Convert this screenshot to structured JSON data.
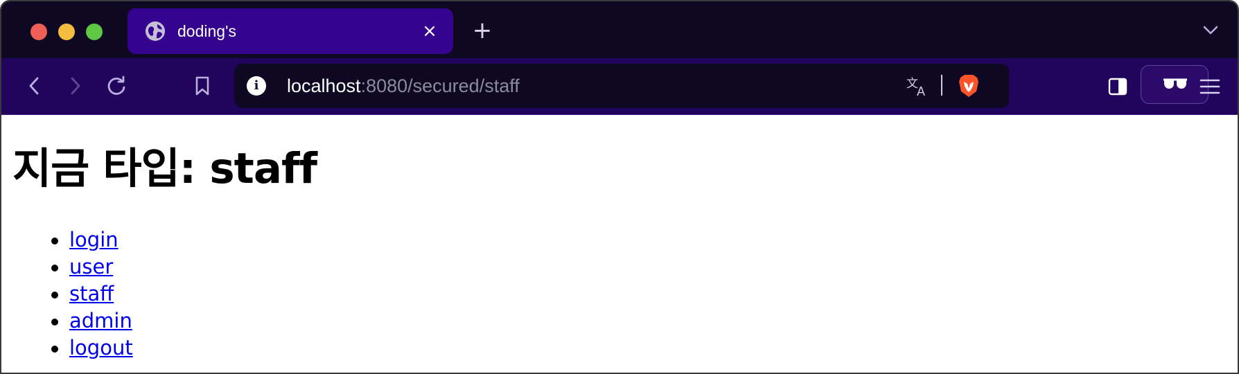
{
  "browser": {
    "tab": {
      "title": "doding's",
      "close_glyph": "×"
    },
    "new_tab_glyph": "+",
    "address": {
      "host": "localhost",
      "rest": ":8080/secured/staff"
    },
    "icons": {
      "back": "chevron-left-icon",
      "forward": "chevron-right-icon",
      "reload": "reload-icon",
      "bookmark": "bookmark-icon",
      "site_info": "info-icon",
      "translate": "translate-icon",
      "brave_shields": "brave-lion-icon",
      "sidebar": "sidebar-icon",
      "vpn": "sunglasses-icon",
      "menu": "hamburger-icon",
      "tabs_dropdown": "chevron-down-icon"
    },
    "info_glyph": "i",
    "colors": {
      "tabstrip": "#0f0823",
      "active_tab": "#35048f",
      "toolbar": "#21045c",
      "link": "#0000ee"
    }
  },
  "page": {
    "heading": "지금 타입: staff",
    "links": [
      {
        "label": "login"
      },
      {
        "label": "user"
      },
      {
        "label": "staff"
      },
      {
        "label": "admin"
      },
      {
        "label": "logout"
      }
    ]
  }
}
